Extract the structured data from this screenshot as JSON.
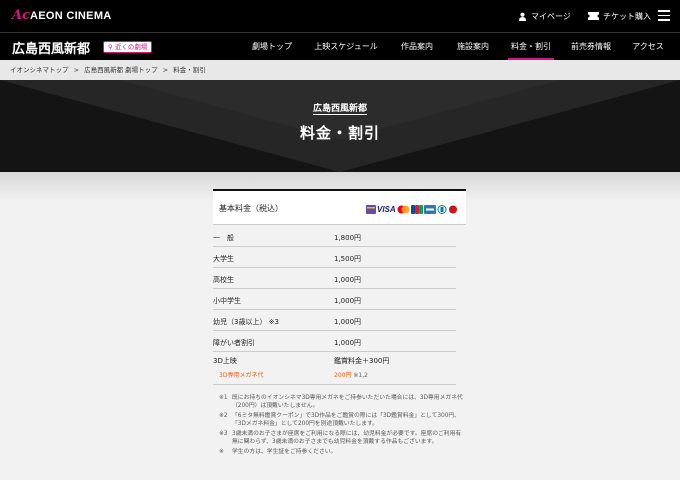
{
  "header": {
    "logo_text": "AEON CINEMA",
    "logo_mark": "Ac",
    "mypage_label": "マイページ",
    "ticket_label": "チケット購入"
  },
  "nav": {
    "theater_name": "広島西風新都",
    "nearby_label": "近くの劇場",
    "items": [
      {
        "label": "劇場トップ"
      },
      {
        "label": "上映スケジュール"
      },
      {
        "label": "作品案内"
      },
      {
        "label": "施設案内"
      },
      {
        "label": "料金・割引"
      },
      {
        "label": "前売券情報"
      },
      {
        "label": "アクセス"
      }
    ],
    "active_index": 4
  },
  "breadcrumb": {
    "items": [
      "イオンシネマトップ",
      "広島西風新都 劇場トップ",
      "料金・割引"
    ],
    "separator": ">"
  },
  "hero": {
    "subtitle": "広島西風新都",
    "title": "料金・割引"
  },
  "pricing": {
    "heading": "基本料金（税込）",
    "payment_icons": [
      "card-generic-icon",
      "visa-icon",
      "mastercard-icon",
      "jcb-icon",
      "amex-icon",
      "diners-icon",
      "waon-icon"
    ],
    "visa_label": "VISA",
    "rows": [
      {
        "label": "一　般",
        "value": "1,800円"
      },
      {
        "label": "大学生",
        "value": "1,500円"
      },
      {
        "label": "高校生",
        "value": "1,000円"
      },
      {
        "label": "小中学生",
        "value": "1,000円"
      },
      {
        "label": "幼児（3歳以上） ※3",
        "value": "1,000円"
      },
      {
        "label": "障がい者割引",
        "value": "1,000円"
      }
    ],
    "row_3d": {
      "label": "3D上映",
      "value": "鑑賞料金＋300円",
      "sub_label": "3D専用メガネ代",
      "sub_value": "200円",
      "sub_note": "※1,2"
    },
    "accent_color": "#e8601c",
    "brand_color": "#d4147e"
  },
  "notes": [
    {
      "mark": "※1",
      "text": "既にお持ちのイオンシネマ3D専用メガネをご持参いただいた場合には、3D専用メガネ代（200円）は頂戴いたしません。"
    },
    {
      "mark": "※2",
      "text": "「6ミタ無料鑑賞クーポン」で3D作品をご鑑賞の際には「3D鑑賞料金」として300円、「3Dメガネ料金」として200円を別途頂戴いたします。"
    },
    {
      "mark": "※3",
      "text": "3歳未満のお子さまが座席をご利用になる際には、幼児料金が必要です。座席のご利用有無に関わらず、3歳未満のお子さまでも幼児料金を頂戴する作品もございます。"
    },
    {
      "mark": "※",
      "text": "学生の方は、学生証をご持参ください。"
    }
  ]
}
